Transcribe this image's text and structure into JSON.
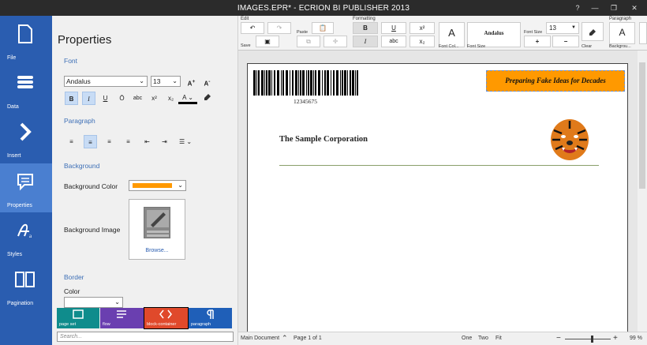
{
  "window": {
    "title": "IMAGES.EPR* - ECRION BI PUBLISHER 2013",
    "controls": [
      "?",
      "—",
      "❐",
      "✕"
    ]
  },
  "nav": {
    "items": [
      {
        "label": "File",
        "icon": "file-icon"
      },
      {
        "label": "Data",
        "icon": "data-icon"
      },
      {
        "label": "Insert",
        "icon": "insert-icon"
      },
      {
        "label": "Properties",
        "icon": "properties-icon",
        "active": true
      },
      {
        "label": "Styles",
        "icon": "styles-icon"
      },
      {
        "label": "Pagination",
        "icon": "pagination-icon"
      }
    ]
  },
  "properties": {
    "title": "Properties",
    "font": {
      "section": "Font",
      "family": "Andalus",
      "size": "13",
      "grow": "A",
      "shrink": "A",
      "bold": "B",
      "italic": "I",
      "underline": "U",
      "overline": "Ō",
      "strike": "abc",
      "superscript": "x²",
      "subscript": "x₂",
      "color": "A"
    },
    "paragraph": {
      "section": "Paragraph"
    },
    "background": {
      "section": "Background",
      "color_label": "Background Color",
      "color_value": "#ff9900",
      "image_label": "Background Image",
      "browse": "Browse..."
    },
    "border": {
      "section": "Border",
      "color_label": "Color"
    },
    "palette": [
      {
        "label": "page set",
        "color": "#0f8c8c"
      },
      {
        "label": "flow",
        "color": "#6a3fb0"
      },
      {
        "label": "block-container",
        "color": "#e0492b"
      },
      {
        "label": "paragraph",
        "color": "#1f5fb8"
      }
    ],
    "search_placeholder": "Search..."
  },
  "ribbon": {
    "edit": {
      "group": "Edit",
      "save": "Save",
      "paste": "Paste"
    },
    "formatting": {
      "group": "Formatting",
      "bold": "B",
      "italic": "I",
      "underline": "U",
      "strike": "abc",
      "superscript": "x²",
      "subscript": "x₂",
      "font_color": "Font Col...",
      "font_name": "Andalus",
      "font_size_label": "Font Size",
      "font_size_caption": "Font Size",
      "font_size_value": "13",
      "grow": "+",
      "shrink": "−",
      "clear": "Clear"
    },
    "paragraph": {
      "group": "Paragraph",
      "background": "Backgrou..."
    }
  },
  "document": {
    "barcode_number": "12345675",
    "banner_text": "Preparing Fake Ideas for Decades",
    "banner_color": "#ff9900",
    "company": "The Sample Corporation",
    "rule_color": "#8aa06a"
  },
  "status": {
    "main_document": "Main Document",
    "page": "Page 1 of 1",
    "view_one": "One",
    "view_two": "Two",
    "view_fit": "Fit",
    "zoom": "99 %",
    "zoom_fraction": 0.6
  }
}
